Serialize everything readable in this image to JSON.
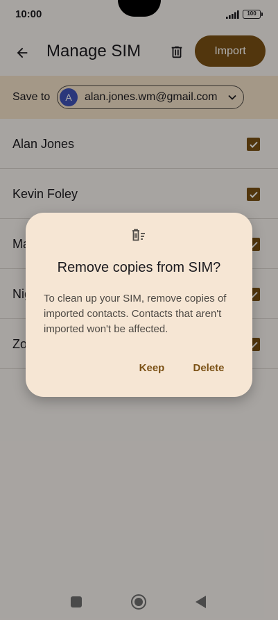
{
  "status_bar": {
    "time": "10:00",
    "battery": "100"
  },
  "app_bar": {
    "title": "Manage SIM",
    "import_label": "Import"
  },
  "save_to": {
    "label": "Save to",
    "avatar_letter": "A",
    "account": "alan.jones.wm@gmail.com"
  },
  "contacts": [
    {
      "name": "Alan Jones",
      "checked": true
    },
    {
      "name": "Kevin Foley",
      "checked": true
    },
    {
      "name": "Ma",
      "checked": true
    },
    {
      "name": "Nig",
      "checked": true
    },
    {
      "name": "Zo",
      "checked": true
    }
  ],
  "dialog": {
    "title": "Remove copies from SIM?",
    "body": "To clean up your SIM, remove copies of imported contacts. Contacts that aren't imported won't be affected.",
    "keep_label": "Keep",
    "delete_label": "Delete"
  },
  "colors": {
    "accent": "#7a5014",
    "dialog_bg": "#f6e6d4",
    "save_row_bg": "#f2e0c8"
  }
}
